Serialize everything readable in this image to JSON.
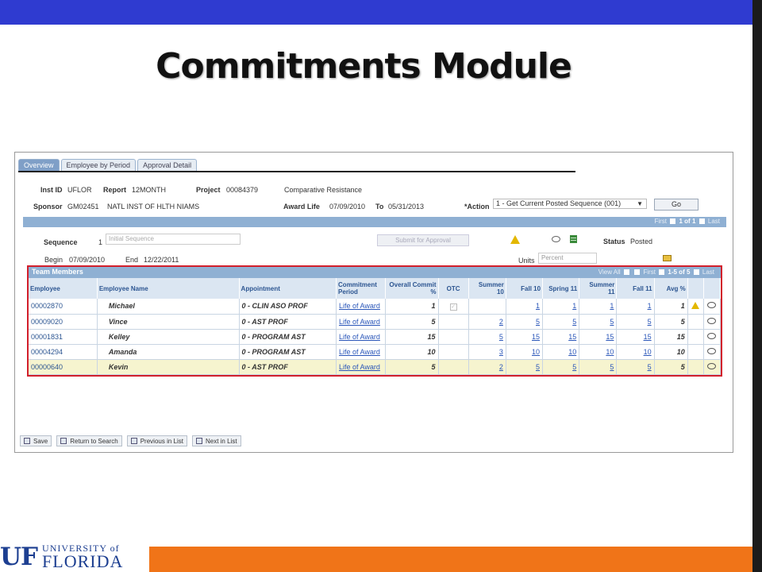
{
  "slide": {
    "title": "Commitments Module",
    "logo_mark": "UF",
    "logo_line1": "UNIVERSITY of",
    "logo_line2": "FLORIDA"
  },
  "tabs": [
    {
      "label": "Overview",
      "active": true
    },
    {
      "label": "Employee by Period",
      "active": false
    },
    {
      "label": "Approval Detail",
      "active": false
    }
  ],
  "header": {
    "inst_id_label": "Inst ID",
    "inst_id": "UFLOR",
    "report_label": "Report",
    "report": "12MONTH",
    "project_label": "Project",
    "project": "00084379",
    "project_desc": "Comparative Resistance",
    "sponsor_label": "Sponsor",
    "sponsor": "GM02451",
    "sponsor_desc": "NATL INST OF HLTH NIAMS",
    "award_life_label": "Award Life",
    "award_start": "07/09/2010",
    "to_label": "To",
    "award_end": "05/31/2013",
    "action_label": "*Action",
    "action_value": "1 - Get Current Posted Sequence (001)",
    "go_label": "Go"
  },
  "sequence_pager": {
    "first": "First",
    "range": "1 of 1",
    "last": "Last"
  },
  "sequence": {
    "sequence_label": "Sequence",
    "sequence_value": "1",
    "sequence_placeholder": "Initial Sequence",
    "submit_label": "Submit for Approval",
    "status_label": "Status",
    "status_value": "Posted",
    "begin_label": "Begin",
    "begin_value": "07/09/2010",
    "end_label": "End",
    "end_value": "12/22/2011",
    "units_label": "Units",
    "units_value": "Percent"
  },
  "team": {
    "title": "Team Members",
    "view_all": "View All",
    "first": "First",
    "range": "1-5 of 5",
    "last": "Last",
    "columns": {
      "employee": "Employee",
      "employee_name": "Employee Name",
      "appointment": "Appointment",
      "commitment_period": "Commitment Period",
      "overall": "Overall Commit %",
      "otc": "OTC",
      "summer10": "Summer 10",
      "fall10": "Fall 10",
      "spring11": "Spring 11",
      "summer11": "Summer 11",
      "fall11": "Fall 11",
      "avg": "Avg %"
    },
    "rows": [
      {
        "employee": "00002870",
        "name": "Michael",
        "appointment": "0 - CLIN ASO PROF",
        "period": "Life of Award",
        "overall": "1",
        "summer10": "",
        "fall10": "1",
        "spring11": "1",
        "summer11": "1",
        "fall11": "1",
        "avg": "1"
      },
      {
        "employee": "00009020",
        "name": "Vince",
        "appointment": "0 - AST PROF",
        "period": "Life of Award",
        "overall": "5",
        "summer10": "2",
        "fall10": "5",
        "spring11": "5",
        "summer11": "5",
        "fall11": "5",
        "avg": "5"
      },
      {
        "employee": "00001831",
        "name": "Kelley",
        "appointment": "0 - PROGRAM AST",
        "period": "Life of Award",
        "overall": "15",
        "summer10": "5",
        "fall10": "15",
        "spring11": "15",
        "summer11": "15",
        "fall11": "15",
        "avg": "15"
      },
      {
        "employee": "00004294",
        "name": "Amanda",
        "appointment": "0 - PROGRAM AST",
        "period": "Life of Award",
        "overall": "10",
        "summer10": "3",
        "fall10": "10",
        "spring11": "10",
        "summer11": "10",
        "fall11": "10",
        "avg": "10"
      },
      {
        "employee": "00000640",
        "name": "Kevin",
        "appointment": "0 - AST PROF",
        "period": "Life of Award",
        "overall": "5",
        "summer10": "2",
        "fall10": "5",
        "spring11": "5",
        "summer11": "5",
        "fall11": "5",
        "avg": "5"
      }
    ]
  },
  "toolbar": {
    "save": "Save",
    "return": "Return to Search",
    "previous": "Previous in List",
    "next": "Next in List"
  },
  "colors": {
    "top_bar": "#2f3bd0",
    "bottom_bar": "#f07418",
    "grid_header": "#8fb0d3",
    "highlight_box": "#d21f2b",
    "selected_row": "#f6f4cf"
  }
}
